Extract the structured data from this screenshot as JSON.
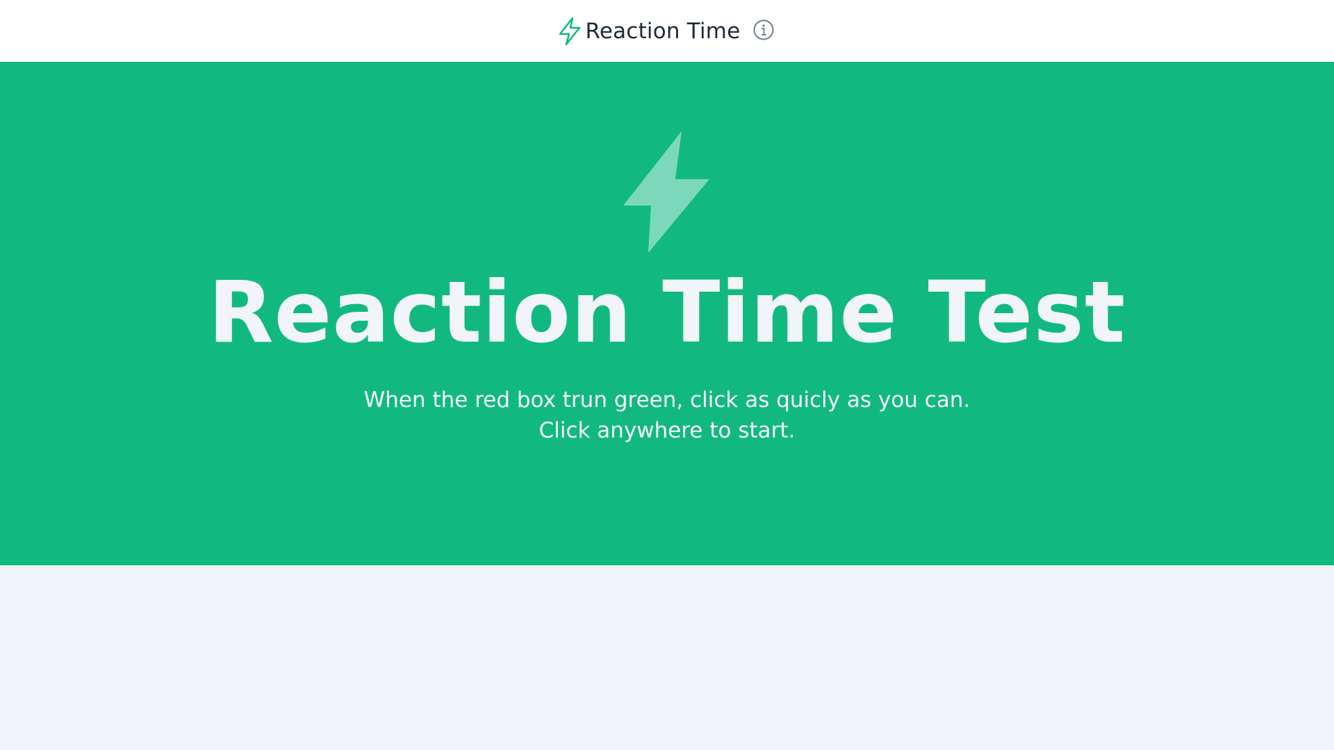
{
  "header": {
    "brand_icon": "lightning-bolt-icon",
    "title": "Reaction Time",
    "info_icon": "info-icon"
  },
  "hero": {
    "icon": "lightning-bolt-icon",
    "title": "Reaction Time Test",
    "instruction_line1": "When the red box trun green, click as quicly as you can.",
    "instruction_line2": "Click anywhere to start."
  },
  "colors": {
    "accent": "#11b981",
    "header_bg": "#ffffff",
    "page_bg": "#f0f4f8",
    "title_text": "#1f2937"
  }
}
